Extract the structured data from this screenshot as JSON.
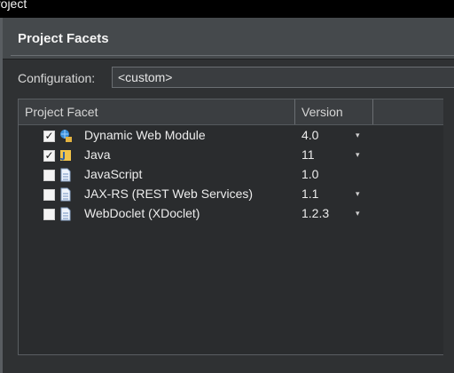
{
  "window": {
    "title": "roject"
  },
  "header": {
    "title": "Project Facets"
  },
  "configuration": {
    "label": "Configuration:",
    "value": "<custom>"
  },
  "table": {
    "columns": {
      "facet": "Project Facet",
      "version": "Version"
    },
    "rows": [
      {
        "name": "Dynamic Web Module",
        "version": "4.0",
        "checked": "✓",
        "icon": "web-module-icon",
        "dropdown": "▾"
      },
      {
        "name": "Java",
        "version": "11",
        "checked": "✓",
        "icon": "java-icon",
        "dropdown": "▾"
      },
      {
        "name": "JavaScript",
        "version": "1.0",
        "checked": "",
        "icon": "document-icon",
        "dropdown": ""
      },
      {
        "name": "JAX-RS (REST Web Services)",
        "version": "1.1",
        "checked": "",
        "icon": "document-icon",
        "dropdown": "▾"
      },
      {
        "name": "WebDoclet (XDoclet)",
        "version": "1.2.3",
        "checked": "",
        "icon": "document-icon",
        "dropdown": "▾"
      }
    ]
  }
}
